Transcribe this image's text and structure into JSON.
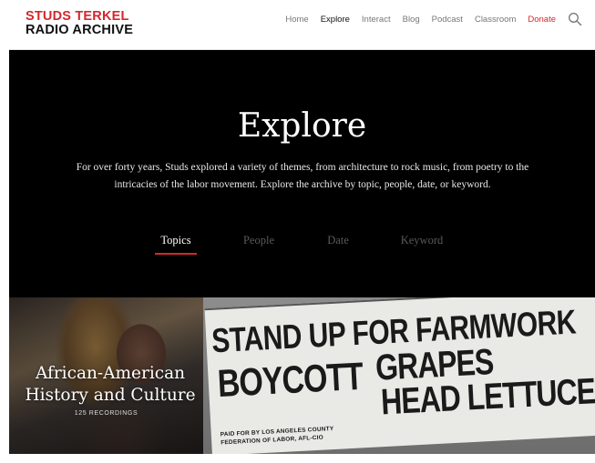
{
  "header": {
    "logo_line1": "STUDS TERKEL",
    "logo_line2": "RADIO ARCHIVE",
    "nav": [
      {
        "label": "Home"
      },
      {
        "label": "Explore"
      },
      {
        "label": "Interact"
      },
      {
        "label": "Blog"
      },
      {
        "label": "Podcast"
      },
      {
        "label": "Classroom"
      },
      {
        "label": "Donate"
      }
    ],
    "search_icon": "search-icon",
    "active_nav": "Explore"
  },
  "hero": {
    "title": "Explore",
    "description": "For over forty years, Studs explored a variety of themes, from architecture to rock music, from poetry to the intricacies of the labor movement. Explore the archive by topic, people, date, or keyword.",
    "tabs": [
      {
        "label": "Topics"
      },
      {
        "label": "People"
      },
      {
        "label": "Date"
      },
      {
        "label": "Keyword"
      }
    ],
    "active_tab": "Topics"
  },
  "cards": [
    {
      "title_line1": "African-American",
      "title_line2": "History and Culture",
      "count": "125 RECORDINGS"
    },
    {
      "sign_line1": "STAND UP FOR FARMWORK",
      "sign_line2": "BOYCOTT",
      "sign_line3": "GRAPES",
      "sign_line4": "HEAD LETTUCE",
      "sign_small1": "PAID FOR BY LOS ANGELES COUNTY",
      "sign_small2": "FEDERATION OF LABOR, AFL-CIO"
    }
  ],
  "colors": {
    "brand_red": "#d5272d",
    "hero_bg": "#000000",
    "header_bg": "#ffffff"
  }
}
